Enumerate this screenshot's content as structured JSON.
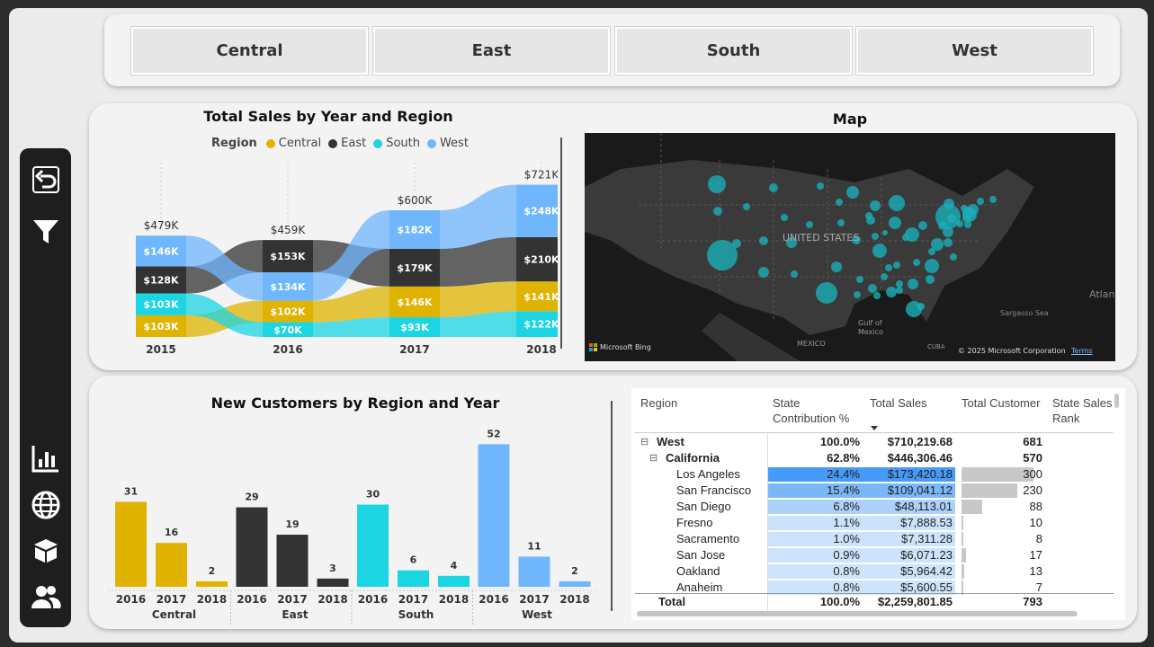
{
  "slicer": {
    "buttons": [
      "Central",
      "East",
      "South",
      "West"
    ]
  },
  "sidebar": {
    "icons": [
      "back-icon",
      "filter-icon",
      "bar-chart-icon",
      "globe-icon",
      "box-icon",
      "users-icon"
    ]
  },
  "colors": {
    "central": "#dfb300",
    "east": "#333333",
    "south": "#1bd5e3",
    "west": "#6fb6fd"
  },
  "ribbon": {
    "title": "Total Sales by Year and Region",
    "legend_title": "Region",
    "legend": [
      "Central",
      "East",
      "South",
      "West"
    ],
    "years": [
      "2015",
      "2016",
      "2017",
      "2018"
    ],
    "totals": [
      "$479K",
      "$459K",
      "$600K",
      "$721K"
    ]
  },
  "map": {
    "title": "Map",
    "label_country": "UNITED STATES",
    "label_mexico": "MEXICO",
    "label_gulf": "Gulf of\nMexico",
    "label_cuba": "CUBA",
    "label_sargasso": "Sargasso Sea",
    "label_atlantic": "Atlan",
    "bing": "Microsoft Bing",
    "copyright": "© 2025 Microsoft Corporation",
    "terms": "Terms"
  },
  "bars": {
    "title": "New Customers by Region and Year",
    "regions": [
      "Central",
      "East",
      "South",
      "West"
    ],
    "years": [
      "2016",
      "2017",
      "2018"
    ]
  },
  "chart_data": [
    {
      "type": "area",
      "title": "Total Sales by Year and Region",
      "x": [
        "2015",
        "2016",
        "2017",
        "2018"
      ],
      "legend_title": "Region",
      "series": [
        {
          "name": "Central",
          "labels": [
            "$103K",
            "$102K",
            "$146K",
            "$141K"
          ],
          "values": [
            103,
            102,
            146,
            141
          ]
        },
        {
          "name": "East",
          "labels": [
            "$128K",
            "$153K",
            "$179K",
            "$210K"
          ],
          "values": [
            128,
            153,
            179,
            210
          ]
        },
        {
          "name": "South",
          "labels": [
            "$103K",
            "$70K",
            "$93K",
            "$122K"
          ],
          "values": [
            103,
            70,
            93,
            122
          ]
        },
        {
          "name": "West",
          "labels": [
            "$146K",
            "$134K",
            "$182K",
            "$248K"
          ],
          "values": [
            146,
            134,
            182,
            248
          ]
        }
      ],
      "totals": [
        "$479K",
        "$459K",
        "$600K",
        "$721K"
      ]
    },
    {
      "type": "bar",
      "title": "New Customers by Region and Year",
      "groups": [
        "Central",
        "East",
        "South",
        "West"
      ],
      "categories": [
        "2016",
        "2017",
        "2018"
      ],
      "series": [
        {
          "name": "Central",
          "values": [
            31,
            16,
            2
          ]
        },
        {
          "name": "East",
          "values": [
            29,
            19,
            3
          ]
        },
        {
          "name": "South",
          "values": [
            30,
            6,
            4
          ]
        },
        {
          "name": "West",
          "values": [
            52,
            11,
            2
          ]
        }
      ]
    }
  ],
  "matrix": {
    "headers": [
      "Region",
      "State\nContribution %",
      "Total Sales",
      "Total Customer",
      "State Sales\nRank"
    ],
    "rows": [
      {
        "level": 0,
        "name": "West",
        "pct": "100.0%",
        "sales": "$710,219.68",
        "cust": "681",
        "pctv": 0,
        "salesv": 0,
        "custv": 0,
        "bold": true,
        "toggle": "⊟"
      },
      {
        "level": 1,
        "name": "California",
        "pct": "62.8%",
        "sales": "$446,306.46",
        "cust": "570",
        "pctv": 0,
        "salesv": 0,
        "custv": 0,
        "bold": true,
        "toggle": "⊟"
      },
      {
        "level": 2,
        "name": "Los Angeles",
        "pct": "24.4%",
        "sales": "$173,420.18",
        "cust": "300",
        "pctv": 1.0,
        "salesv": 1.0,
        "custv": 1.0
      },
      {
        "level": 2,
        "name": "San Francisco",
        "pct": "15.4%",
        "sales": "$109,041.12",
        "cust": "230",
        "pctv": 0.63,
        "salesv": 0.63,
        "custv": 0.77
      },
      {
        "level": 2,
        "name": "San Diego",
        "pct": "6.8%",
        "sales": "$48,113.01",
        "cust": "88",
        "pctv": 0.28,
        "salesv": 0.28,
        "custv": 0.29
      },
      {
        "level": 2,
        "name": "Fresno",
        "pct": "1.1%",
        "sales": "$7,888.53",
        "cust": "10",
        "pctv": 0.05,
        "salesv": 0.05,
        "custv": 0.03
      },
      {
        "level": 2,
        "name": "Sacramento",
        "pct": "1.0%",
        "sales": "$7,311.28",
        "cust": "8",
        "pctv": 0.04,
        "salesv": 0.04,
        "custv": 0.03
      },
      {
        "level": 2,
        "name": "San Jose",
        "pct": "0.9%",
        "sales": "$6,071.23",
        "cust": "17",
        "pctv": 0.04,
        "salesv": 0.04,
        "custv": 0.06
      },
      {
        "level": 2,
        "name": "Oakland",
        "pct": "0.8%",
        "sales": "$5,964.42",
        "cust": "13",
        "pctv": 0.03,
        "salesv": 0.03,
        "custv": 0.04
      },
      {
        "level": 2,
        "name": "Anaheim",
        "pct": "0.8%",
        "sales": "$5,600.55",
        "cust": "7",
        "pctv": 0.03,
        "salesv": 0.03,
        "custv": 0.02
      }
    ],
    "total": {
      "name": "Total",
      "pct": "100.0%",
      "sales": "$2,259,801.85",
      "cust": "793"
    }
  }
}
